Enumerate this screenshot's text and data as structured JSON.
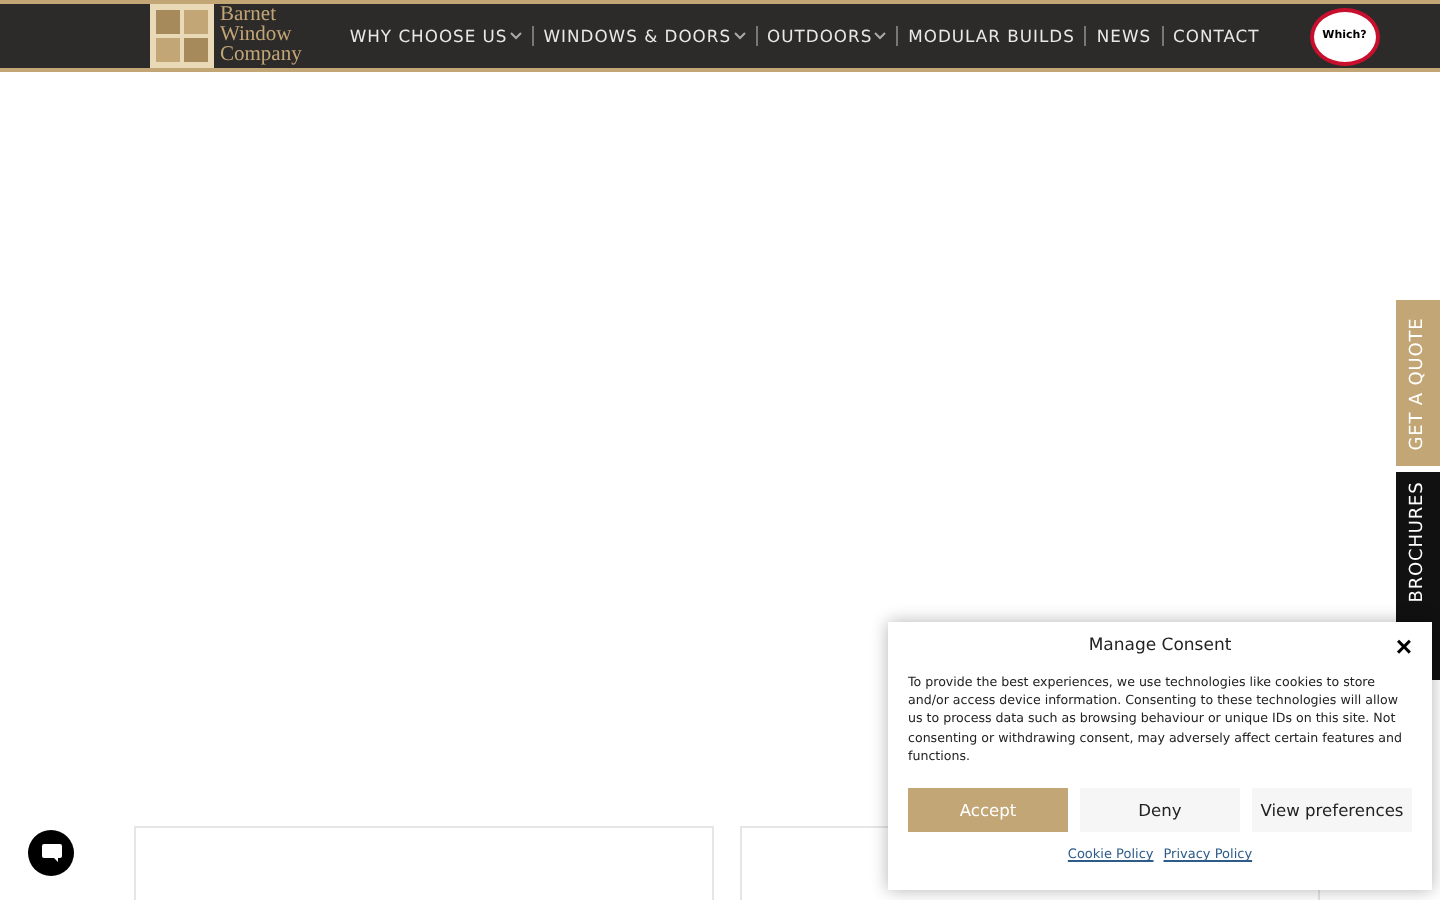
{
  "header": {
    "logo": [
      "Barnet",
      "Window",
      "Company"
    ],
    "nav": [
      {
        "label": "WHY CHOOSE US",
        "dropdown": true
      },
      {
        "label": "WINDOWS & DOORS",
        "dropdown": true
      },
      {
        "label": "OUTDOORS",
        "dropdown": true
      },
      {
        "label": "MODULAR BUILDS",
        "dropdown": false
      },
      {
        "label": "NEWS",
        "dropdown": false
      },
      {
        "label": "CONTACT",
        "dropdown": false
      }
    ],
    "badge": {
      "title": "Which?"
    }
  },
  "side_tabs": [
    {
      "label": "GET A QUOTE",
      "kind": "gold"
    },
    {
      "label": "BROCHURES",
      "kind": "dark"
    }
  ],
  "cards": [
    {
      "kind": "card"
    },
    {
      "kind": "card"
    }
  ],
  "consent": {
    "title": "Manage Consent",
    "close": "×",
    "text": "To provide the best experiences, we use technologies like cookies to store and/or access device information. Consenting to these technologies will allow us to process data such as browsing behaviour or unique IDs on this site. Not consenting or withdrawing consent, may adversely affect certain features and functions.",
    "buttons": [
      {
        "label": "Accept",
        "kind": "primary"
      },
      {
        "label": "Deny",
        "kind": "secondary"
      },
      {
        "label": "View preferences",
        "kind": "secondary"
      }
    ],
    "links": [
      "Cookie Policy",
      "Privacy Policy"
    ]
  }
}
